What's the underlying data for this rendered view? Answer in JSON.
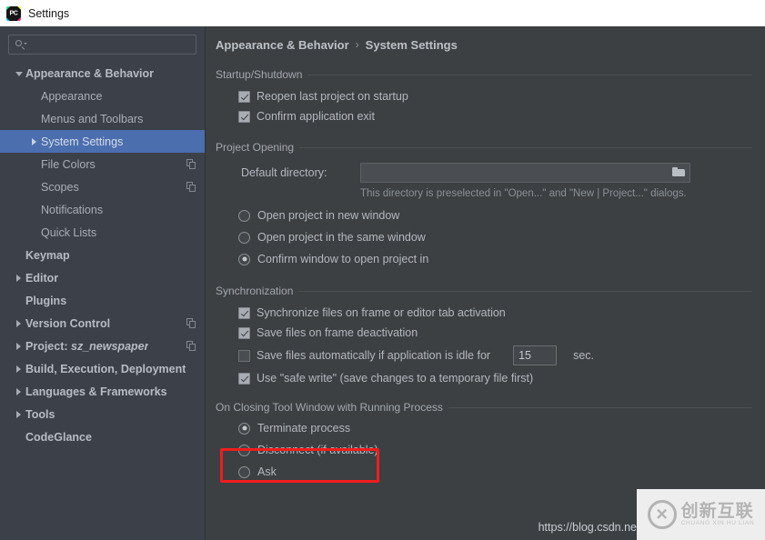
{
  "titlebar": {
    "title": "Settings",
    "app_icon": "pycharm-logo"
  },
  "sidebar": {
    "search": {
      "value": "",
      "placeholder": "",
      "icon": "search-icon"
    },
    "items": [
      {
        "label": "Appearance & Behavior",
        "indent": 0,
        "twisty": "expanded",
        "bold": true,
        "selected": false,
        "copy_icon": false
      },
      {
        "label": "Appearance",
        "indent": 1,
        "twisty": "none",
        "bold": false,
        "selected": false,
        "copy_icon": false
      },
      {
        "label": "Menus and Toolbars",
        "indent": 1,
        "twisty": "none",
        "bold": false,
        "selected": false,
        "copy_icon": false
      },
      {
        "label": "System Settings",
        "indent": 1,
        "twisty": "collapsed",
        "bold": false,
        "selected": true,
        "copy_icon": false
      },
      {
        "label": "File Colors",
        "indent": 1,
        "twisty": "none",
        "bold": false,
        "selected": false,
        "copy_icon": true
      },
      {
        "label": "Scopes",
        "indent": 1,
        "twisty": "none",
        "bold": false,
        "selected": false,
        "copy_icon": true
      },
      {
        "label": "Notifications",
        "indent": 1,
        "twisty": "none",
        "bold": false,
        "selected": false,
        "copy_icon": false
      },
      {
        "label": "Quick Lists",
        "indent": 1,
        "twisty": "none",
        "bold": false,
        "selected": false,
        "copy_icon": false
      },
      {
        "label": "Keymap",
        "indent": 0,
        "twisty": "none",
        "bold": true,
        "selected": false,
        "copy_icon": false
      },
      {
        "label": "Editor",
        "indent": 0,
        "twisty": "collapsed",
        "bold": true,
        "selected": false,
        "copy_icon": false
      },
      {
        "label": "Plugins",
        "indent": 0,
        "twisty": "none",
        "bold": true,
        "selected": false,
        "copy_icon": false
      },
      {
        "label": "Version Control",
        "indent": 0,
        "twisty": "collapsed",
        "bold": true,
        "selected": false,
        "copy_icon": true
      },
      {
        "label": "Project: sz_newspaper",
        "indent": 0,
        "twisty": "collapsed",
        "bold": true,
        "selected": false,
        "copy_icon": true,
        "italic_part": "sz_newspaper",
        "prefix": "Project: "
      },
      {
        "label": "Build, Execution, Deployment",
        "indent": 0,
        "twisty": "collapsed",
        "bold": true,
        "selected": false,
        "copy_icon": false
      },
      {
        "label": "Languages & Frameworks",
        "indent": 0,
        "twisty": "collapsed",
        "bold": true,
        "selected": false,
        "copy_icon": false
      },
      {
        "label": "Tools",
        "indent": 0,
        "twisty": "collapsed",
        "bold": true,
        "selected": false,
        "copy_icon": false
      },
      {
        "label": "CodeGlance",
        "indent": 0,
        "twisty": "none",
        "bold": true,
        "selected": false,
        "copy_icon": false
      }
    ]
  },
  "breadcrumb": {
    "parent": "Appearance & Behavior",
    "separator": "›",
    "current": "System Settings"
  },
  "groups": {
    "startup": {
      "title": "Startup/Shutdown",
      "checkboxes": [
        {
          "label": "Reopen last project on startup",
          "checked": true
        },
        {
          "label": "Confirm application exit",
          "checked": true
        }
      ]
    },
    "project_opening": {
      "title": "Project Opening",
      "directory_label": "Default directory:",
      "directory_value": "",
      "directory_placeholder": "",
      "browse_icon": "folder-icon",
      "hint": "This directory is preselected in \"Open...\" and \"New | Project...\" dialogs.",
      "radios": [
        {
          "label": "Open project in new window",
          "selected": false
        },
        {
          "label": "Open project in the same window",
          "selected": false
        },
        {
          "label": "Confirm window to open project in",
          "selected": true
        }
      ]
    },
    "synchronization": {
      "title": "Synchronization",
      "checkboxes": [
        {
          "label": "Synchronize files on frame or editor tab activation",
          "checked": true
        },
        {
          "label": "Save files on frame deactivation",
          "checked": true
        }
      ],
      "idle": {
        "label": "Save files automatically if application is idle for",
        "checked": false,
        "value": "15",
        "unit": "sec."
      },
      "safe_write": {
        "label": "Use \"safe write\" (save changes to a temporary file first)",
        "checked": true
      }
    },
    "closing_tool_window": {
      "title": "On Closing Tool Window with Running Process",
      "radios": [
        {
          "label": "Terminate process",
          "selected": true
        },
        {
          "label": "Disconnect (if available)",
          "selected": false
        },
        {
          "label": "Ask",
          "selected": false
        }
      ]
    }
  },
  "annotation": {
    "color": "#f21c1c",
    "target": "Terminate process"
  },
  "watermark": {
    "cn": "创新互联",
    "pinyin": "CHUANG XIN HU LIAN",
    "logo": "circle-x-logo"
  },
  "url_text": "https://blog.csdn.ne",
  "colors": {
    "titlebar_bg": "#ffffff",
    "sidebar_bg": "#3c4149",
    "main_bg": "#3c4043",
    "selection_blue": "#4b6eaf",
    "text": "#b4b9c0",
    "annotation_red": "#f21c1c"
  }
}
